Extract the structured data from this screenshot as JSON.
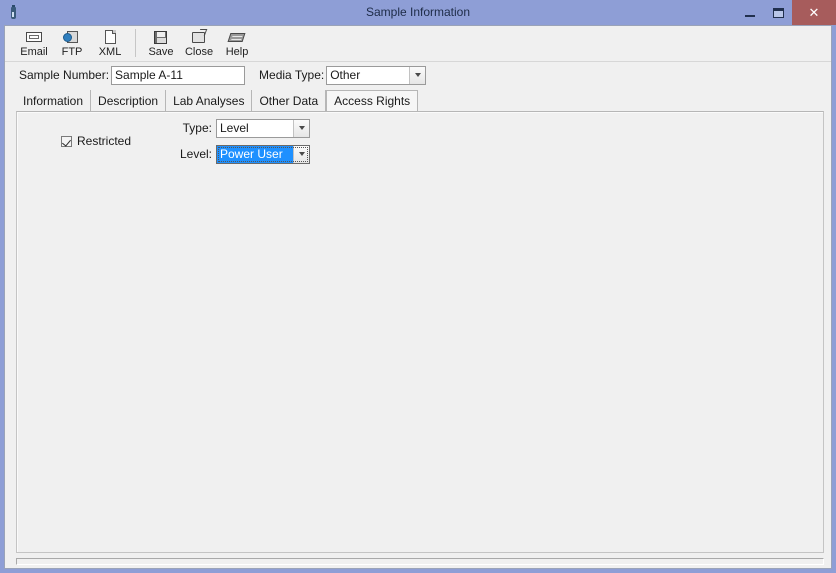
{
  "window": {
    "title": "Sample Information",
    "icon": "flask-icon",
    "colors": {
      "titlebar": "#8e9ed6",
      "close_button": "#a75c5c",
      "client": "#f0f0f0",
      "selection_highlight": "#1e90ff"
    },
    "controls": {
      "minimize_label": "–",
      "maximize_label": "□",
      "close_label": "✕"
    }
  },
  "toolbar": {
    "groups": [
      {
        "buttons": [
          {
            "label": "Email",
            "icon": "email-icon"
          },
          {
            "label": "FTP",
            "icon": "ftp-icon"
          },
          {
            "label": "XML",
            "icon": "xml-icon"
          }
        ]
      },
      {
        "buttons": [
          {
            "label": "Save",
            "icon": "save-icon"
          },
          {
            "label": "Close",
            "icon": "close-folder-icon"
          },
          {
            "label": "Help",
            "icon": "help-book-icon"
          }
        ]
      }
    ]
  },
  "header": {
    "sample_number": {
      "label": "Sample Number:",
      "value": "Sample A-11"
    },
    "media_type": {
      "label": "Media Type:",
      "value": "Other"
    }
  },
  "tabs": {
    "items": [
      {
        "label": "Information",
        "active": false
      },
      {
        "label": "Description",
        "active": false
      },
      {
        "label": "Lab Analyses",
        "active": false
      },
      {
        "label": "Other Data",
        "active": false
      },
      {
        "label": "Access Rights",
        "active": true
      }
    ],
    "active_index": 4
  },
  "access_rights": {
    "restricted": {
      "label": "Restricted",
      "checked": true
    },
    "type": {
      "label": "Type:",
      "value": "Level"
    },
    "level": {
      "label": "Level:",
      "value": "Power User",
      "focused": true
    }
  }
}
